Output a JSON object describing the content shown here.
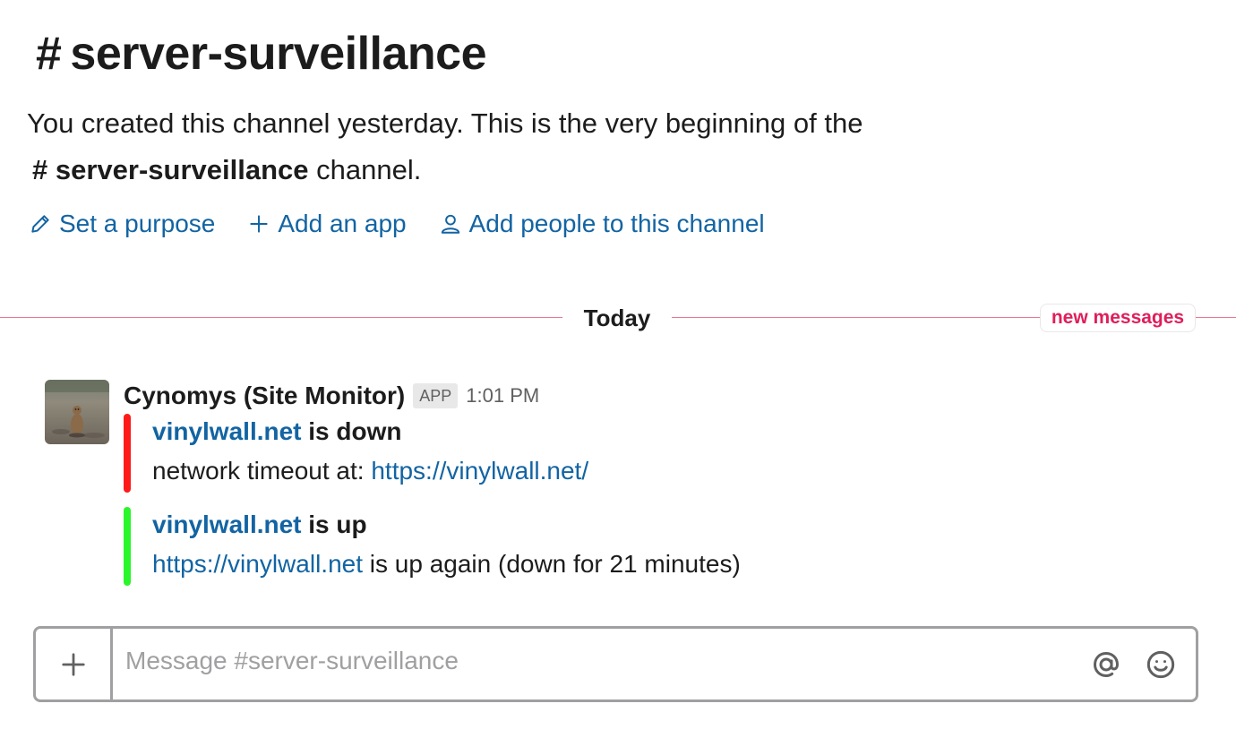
{
  "channel": {
    "hash": "#",
    "name": "server-surveillance"
  },
  "intro": {
    "line1": "You created this channel yesterday. This is the very beginning of the",
    "hash": "#",
    "channel_name": "server-surveillance",
    "suffix": " channel."
  },
  "actions": [
    {
      "label": "Set a purpose",
      "icon": "pencil-icon"
    },
    {
      "label": "Add an app",
      "icon": "plus-icon"
    },
    {
      "label": "Add people to this channel",
      "icon": "person-icon"
    }
  ],
  "divider": {
    "today_label": "Today",
    "new_messages_label": "new messages"
  },
  "message": {
    "sender": "Cynomys (Site Monitor)",
    "badge": "APP",
    "time": "1:01 PM",
    "attachments": [
      {
        "color": "#ff1a1a",
        "title_link": "vinylwall.net",
        "title_suffix": " is down",
        "body_prefix": "network timeout at: ",
        "body_link": "https://vinylwall.net/",
        "body_suffix": ""
      },
      {
        "color": "#2bf52b",
        "title_link": "vinylwall.net",
        "title_suffix": " is up",
        "body_prefix": "",
        "body_link": "https://vinylwall.net",
        "body_suffix": " is up again (down for 21 minutes)"
      }
    ]
  },
  "composer": {
    "placeholder": "Message #server-surveillance",
    "value": ""
  },
  "colors": {
    "link": "#1264a3",
    "new_messages": "#e01e5a",
    "divider": "#e8798e"
  }
}
